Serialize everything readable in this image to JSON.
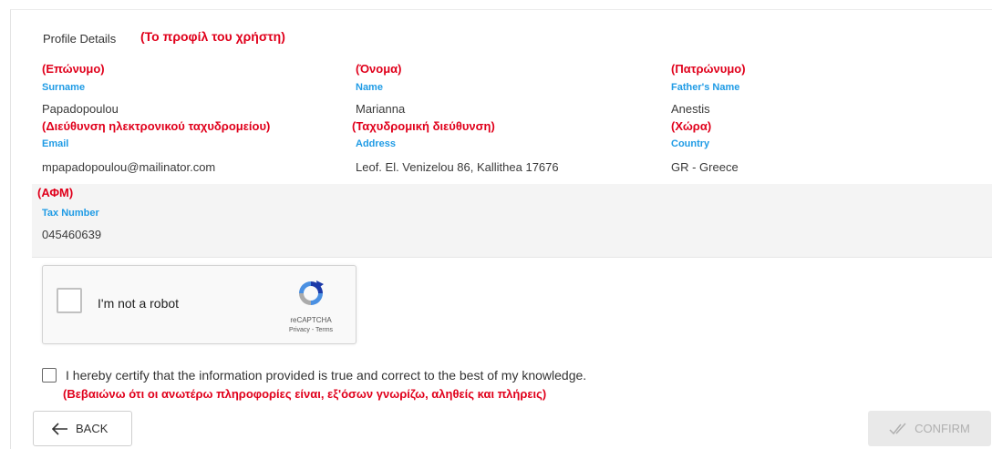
{
  "profile": {
    "title": "Profile Details",
    "title_gr": "(Το προφίλ του χρήστη)"
  },
  "fields": {
    "surname": {
      "gr": "(Επώνυμο)",
      "label": "Surname",
      "value": "Papadopoulou"
    },
    "name": {
      "gr": "(Όνομα)",
      "label": "Name",
      "value": "Marianna"
    },
    "fathers_name": {
      "gr": "(Πατρώνυμο)",
      "label": "Father's Name",
      "value": "Anestis"
    },
    "email": {
      "gr": "(Διεύθυνση ηλεκτρονικού ταχυδρομείου)",
      "label": "Email",
      "value": "mpapadopoulou@mailinator.com"
    },
    "address": {
      "gr": "(Ταχυδρομική διεύθυνση)",
      "label": "Address",
      "value": "Leof. El. Venizelou 86, Kallithea 17676"
    },
    "country": {
      "gr": "(Χώρα)",
      "label": "Country",
      "value": "GR - Greece"
    },
    "tax_number": {
      "gr": "(ΑΦΜ)",
      "label": "Tax Number",
      "value": "045460639"
    }
  },
  "recaptcha": {
    "text": "I'm not a robot",
    "brand": "reCAPTCHA",
    "links": "Privacy - Terms"
  },
  "certify": {
    "text": "I hereby certify that the information provided is true and correct to the best of my knowledge.",
    "text_gr": "(Βεβαιώνω ότι οι ανωτέρω πληροφορίες είναι, εξ'όσων γνωρίζω, αληθείς και πλήρεις)",
    "checked": false
  },
  "actions": {
    "back_label": "BACK",
    "confirm_label": "CONFIRM"
  },
  "colors": {
    "annotation_red": "#e0001b",
    "label_blue": "#1f9be5",
    "disabled_gray": "#b0b0b0"
  }
}
